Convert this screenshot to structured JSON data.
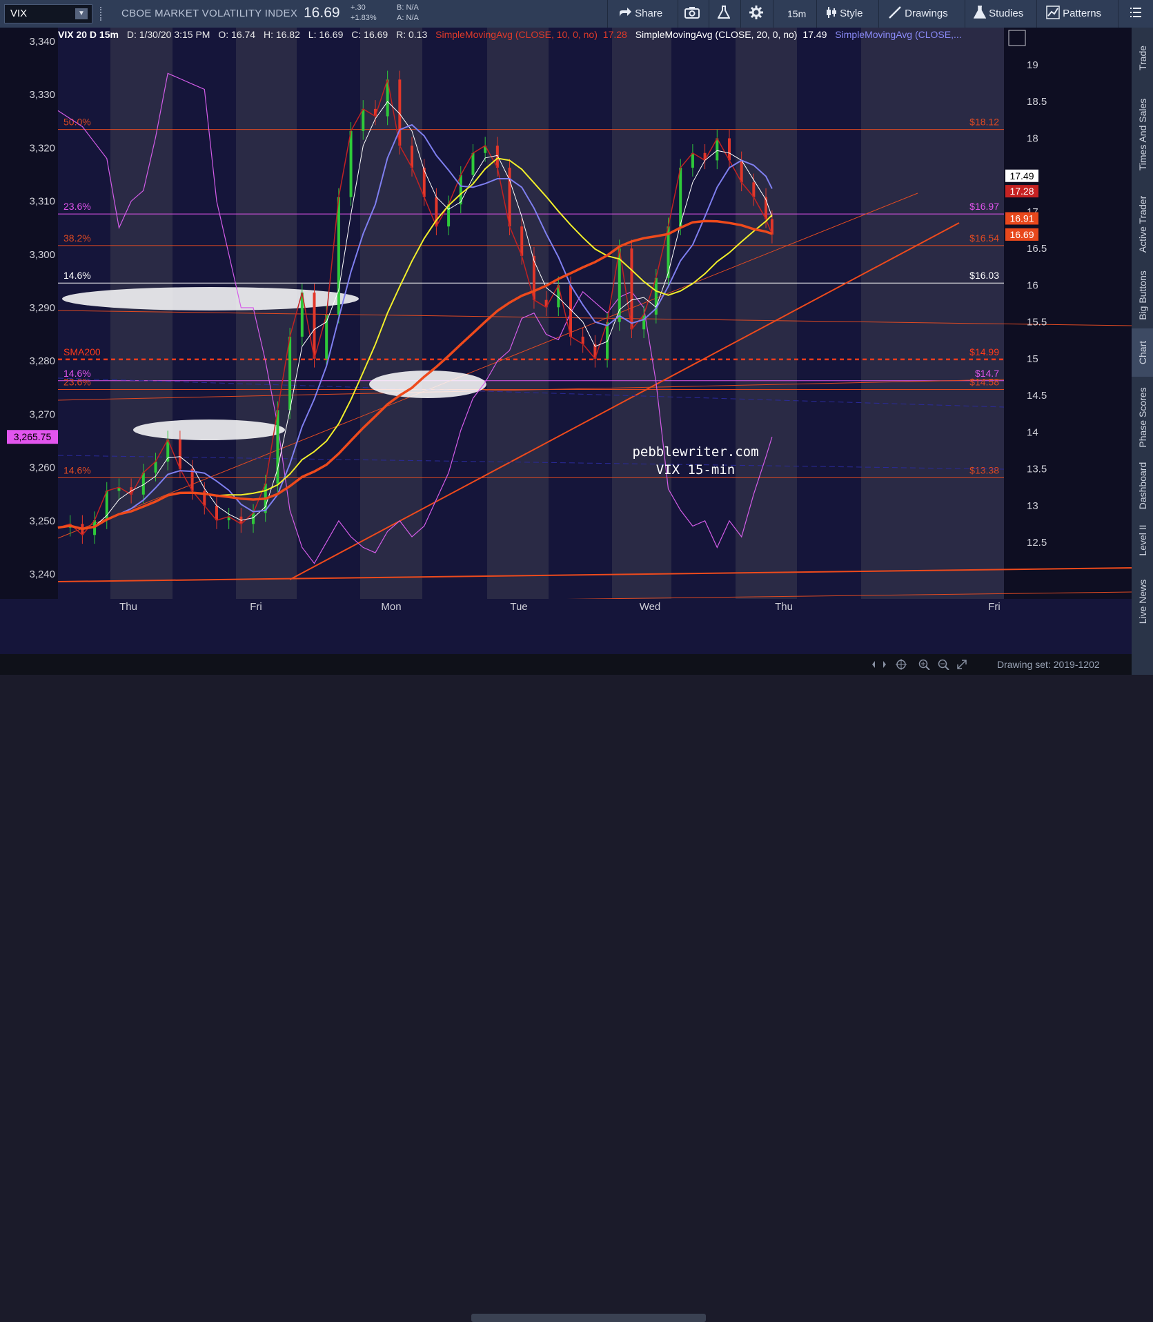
{
  "toolbar": {
    "symbol": "VIX",
    "description": "CBOE MARKET VOLATILITY INDEX",
    "last": "16.69",
    "change": "+.30",
    "change_pct": "+1.83%",
    "bid": "B: N/A",
    "ask": "A: N/A",
    "share": "Share",
    "timeframe": "15m",
    "style": "Style",
    "drawings": "Drawings",
    "studies": "Studies",
    "patterns": "Patterns"
  },
  "info": {
    "label": "VIX 20 D 15m",
    "date": "D: 1/30/20 3:15 PM",
    "open": "O: 16.74",
    "high": "H: 16.82",
    "low": "L: 16.69",
    "close": "C: 16.69",
    "range": "R: 0.13",
    "sma10": "SimpleMovingAvg (CLOSE, 10, 0, no)",
    "sma10_val": "17.28",
    "sma20": "SimpleMovingAvg (CLOSE, 20, 0, no)",
    "sma20_val": "17.49",
    "sma3": "SimpleMovingAvg (CLOSE,..."
  },
  "side_tabs": [
    "Trade",
    "Times And Sales",
    "Active Trader",
    "Big Buttons",
    "Chart",
    "Phase Scores",
    "Dashboard",
    "Level II",
    "Live News"
  ],
  "bottom": {
    "drawing_set": "Drawing set: 2019-1202"
  },
  "watermark": {
    "line1": "pebblewriter.com",
    "line2": "VIX 15-min"
  },
  "colors": {
    "background": "#15153a",
    "stripe_light": "#2e2e48",
    "price": "#d64b2a",
    "sma10": "#c22222",
    "sma20": "#ffffff",
    "sma_blue": "#7f7ff0",
    "sma_yellow": "#f2ef2a",
    "sma200": "#ee4a1c",
    "spx": "#d35ce8",
    "fib_red": "#e04a22",
    "fib_pink": "#e255ee"
  },
  "chart_data": {
    "type": "line",
    "title": "",
    "x_ticks": [
      "Thu",
      "Fri",
      "Mon",
      "Tue",
      "Wed",
      "Thu",
      "Fri"
    ],
    "left_axis": {
      "ticks": [
        "3,340",
        "3,330",
        "3,320",
        "3,310",
        "3,300",
        "3,290",
        "3,280",
        "3,270",
        "3,260",
        "3,250",
        "3,240"
      ],
      "range": [
        3240,
        3340
      ],
      "current_tag": "3,265.75"
    },
    "right_axis": {
      "ticks": [
        "19",
        "18.5",
        "18",
        "17",
        "16.5",
        "16",
        "15.5",
        "15",
        "14.5",
        "14",
        "13.5",
        "13",
        "12.5"
      ],
      "range": [
        12.4,
        19.2
      ]
    },
    "price_tags": [
      {
        "label": "17.49",
        "color": "#ffffff",
        "text_color": "#000000",
        "value": 17.49
      },
      {
        "label": "17.28",
        "color": "#c62222",
        "text_color": "#ffffff",
        "value": 17.28
      },
      {
        "label": "16.91",
        "color": "#e8481c",
        "text_color": "#ffffff",
        "value": 16.91
      },
      {
        "label": "16.69",
        "color": "#e8481c",
        "text_color": "#ffffff",
        "value": 16.69
      }
    ],
    "levels": [
      {
        "left": "50.0%",
        "right": "$18.12",
        "value": 18.12,
        "color": "#e04a22"
      },
      {
        "left": "23.6%",
        "right": "$16.97",
        "value": 16.97,
        "color": "#e255ee"
      },
      {
        "left": "38.2%",
        "right": "$16.54",
        "value": 16.54,
        "color": "#e04a22"
      },
      {
        "left": "14.6%",
        "right": "$16.03",
        "value": 16.03,
        "color": "#ffffff"
      },
      {
        "left": "SMA200",
        "right": "$14.99",
        "value": 14.99,
        "color": "#ff3b1a",
        "dashed": true
      },
      {
        "left": "14.6%",
        "right": "$14.7",
        "value": 14.7,
        "color": "#e255ee"
      },
      {
        "left": "23.6%",
        "right": "$14.58",
        "value": 14.58,
        "color": "#e04a22"
      },
      {
        "left": "14.6%",
        "right": "$13.38",
        "value": 13.38,
        "color": "#e04a22"
      }
    ],
    "series": [
      {
        "name": "VIX 15m",
        "points": [
          [
            0,
            12.7
          ],
          [
            0.02,
            12.75
          ],
          [
            0.04,
            12.6
          ],
          [
            0.06,
            12.8
          ],
          [
            0.08,
            13.2
          ],
          [
            0.1,
            13.25
          ],
          [
            0.12,
            13.15
          ],
          [
            0.14,
            13.45
          ],
          [
            0.16,
            13.6
          ],
          [
            0.18,
            13.9
          ],
          [
            0.2,
            13.5
          ],
          [
            0.22,
            13.2
          ],
          [
            0.24,
            13.0
          ],
          [
            0.26,
            12.8
          ],
          [
            0.28,
            12.85
          ],
          [
            0.3,
            12.75
          ],
          [
            0.32,
            12.9
          ],
          [
            0.34,
            13.3
          ],
          [
            0.36,
            14.3
          ],
          [
            0.38,
            15.3
          ],
          [
            0.4,
            15.9
          ],
          [
            0.42,
            15.0
          ],
          [
            0.44,
            15.6
          ],
          [
            0.46,
            17.2
          ],
          [
            0.48,
            18.1
          ],
          [
            0.5,
            18.4
          ],
          [
            0.52,
            18.3
          ],
          [
            0.54,
            18.8
          ],
          [
            0.56,
            17.9
          ],
          [
            0.58,
            17.6
          ],
          [
            0.6,
            17.2
          ],
          [
            0.62,
            16.8
          ],
          [
            0.64,
            17.1
          ],
          [
            0.66,
            17.5
          ],
          [
            0.68,
            17.8
          ],
          [
            0.7,
            17.9
          ],
          [
            0.72,
            17.6
          ],
          [
            0.74,
            16.8
          ],
          [
            0.76,
            16.4
          ],
          [
            0.78,
            15.8
          ],
          [
            0.8,
            15.7
          ],
          [
            0.82,
            16.0
          ],
          [
            0.84,
            15.3
          ],
          [
            0.86,
            15.2
          ],
          [
            0.88,
            15.0
          ],
          [
            0.9,
            15.5
          ],
          [
            0.92,
            16.5
          ],
          [
            0.94,
            15.4
          ],
          [
            0.96,
            15.6
          ],
          [
            0.98,
            16.1
          ],
          [
            1.0,
            16.8
          ],
          [
            1.02,
            17.6
          ],
          [
            1.04,
            17.8
          ],
          [
            1.06,
            17.7
          ],
          [
            1.08,
            18.0
          ],
          [
            1.1,
            17.7
          ],
          [
            1.12,
            17.4
          ],
          [
            1.14,
            17.2
          ],
          [
            1.16,
            16.9
          ],
          [
            1.17,
            16.69
          ]
        ]
      },
      {
        "name": "SPX",
        "points": [
          [
            0,
            3327
          ],
          [
            0.04,
            3324
          ],
          [
            0.08,
            3318
          ],
          [
            0.1,
            3305
          ],
          [
            0.12,
            3310
          ],
          [
            0.14,
            3312
          ],
          [
            0.16,
            3322
          ],
          [
            0.18,
            3334
          ],
          [
            0.2,
            3333
          ],
          [
            0.22,
            3332
          ],
          [
            0.24,
            3331
          ],
          [
            0.26,
            3310
          ],
          [
            0.28,
            3300
          ],
          [
            0.3,
            3290
          ],
          [
            0.32,
            3290
          ],
          [
            0.34,
            3280
          ],
          [
            0.36,
            3268
          ],
          [
            0.38,
            3252
          ],
          [
            0.4,
            3245
          ],
          [
            0.42,
            3242
          ],
          [
            0.44,
            3246
          ],
          [
            0.46,
            3250
          ],
          [
            0.48,
            3247
          ],
          [
            0.5,
            3245
          ],
          [
            0.52,
            3244
          ],
          [
            0.54,
            3248
          ],
          [
            0.56,
            3250
          ],
          [
            0.58,
            3247
          ],
          [
            0.6,
            3249
          ],
          [
            0.62,
            3254
          ],
          [
            0.64,
            3259
          ],
          [
            0.66,
            3267
          ],
          [
            0.68,
            3273
          ],
          [
            0.7,
            3276
          ],
          [
            0.72,
            3280
          ],
          [
            0.74,
            3282
          ],
          [
            0.76,
            3288
          ],
          [
            0.78,
            3289
          ],
          [
            0.8,
            3285
          ],
          [
            0.82,
            3284
          ],
          [
            0.84,
            3289
          ],
          [
            0.86,
            3293
          ],
          [
            0.88,
            3291
          ],
          [
            0.9,
            3289
          ],
          [
            0.92,
            3292
          ],
          [
            0.94,
            3293
          ],
          [
            0.96,
            3290
          ],
          [
            0.98,
            3276
          ],
          [
            1.0,
            3256
          ],
          [
            1.02,
            3252
          ],
          [
            1.04,
            3249
          ],
          [
            1.06,
            3250
          ],
          [
            1.08,
            3245
          ],
          [
            1.1,
            3250
          ],
          [
            1.12,
            3247
          ],
          [
            1.14,
            3255
          ],
          [
            1.16,
            3262
          ],
          [
            1.17,
            3265.75
          ]
        ]
      }
    ]
  }
}
